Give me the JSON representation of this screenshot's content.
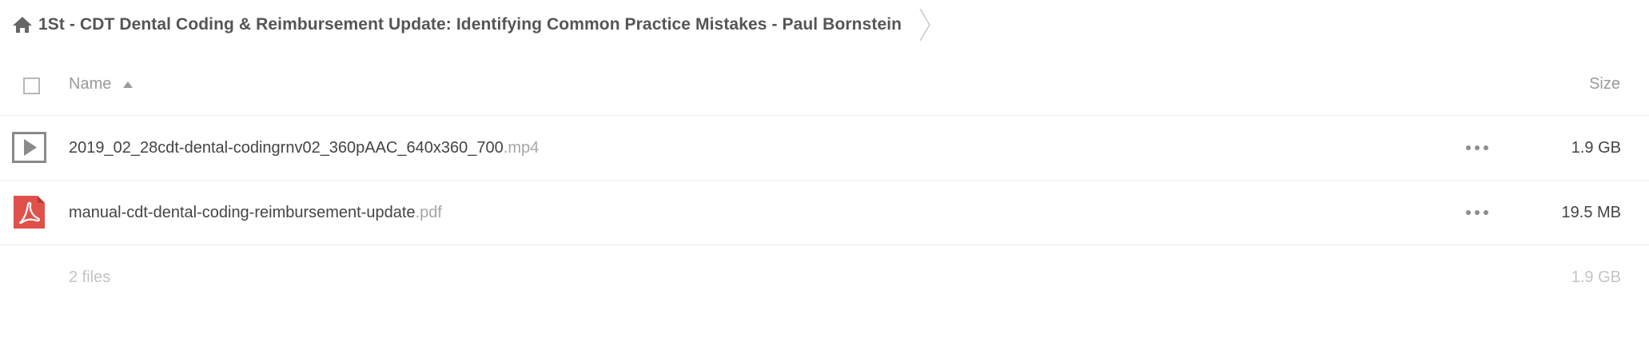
{
  "breadcrumb": {
    "home_icon": "home-icon",
    "folder_title": "1St - CDT Dental Coding & Reimbursement Update: Identifying Common Practice Mistakes - Paul Bornstein"
  },
  "table": {
    "header": {
      "name_label": "Name",
      "size_label": "Size",
      "sort_icon": "sort-ascending-icon"
    },
    "files": [
      {
        "icon": "video-play-icon",
        "base_name": "2019_02_28cdt-dental-codingrnv02_360pAAC_640x360_700",
        "extension": ".mp4",
        "size": "1.9 GB"
      },
      {
        "icon": "pdf-icon",
        "base_name": "manual-cdt-dental-coding-reimbursement-update",
        "extension": ".pdf",
        "size": "19.5 MB"
      }
    ],
    "summary": {
      "file_count": "2 files",
      "total_size": "1.9 GB"
    }
  },
  "colors": {
    "pdf_red": "#e0514a",
    "video_icon_gray": "#8a8a8a",
    "text_dark": "#444444",
    "text_muted": "#9a9a9a"
  }
}
